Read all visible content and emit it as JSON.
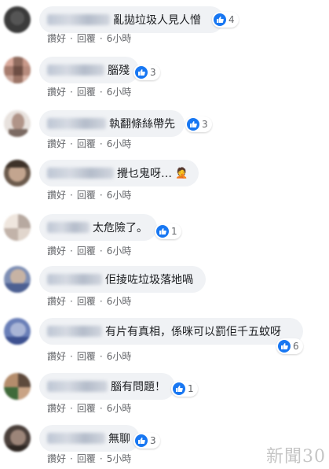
{
  "comments": [
    {
      "name_blur": "",
      "text": "亂拋垃圾人見人憎",
      "emoji": "",
      "likes": "4",
      "actions": {
        "like": "讚好",
        "reply": "回覆",
        "time": "6小時"
      }
    },
    {
      "name_blur": "",
      "text": "腦殘",
      "emoji": "",
      "likes": "3",
      "actions": {
        "like": "讚好",
        "reply": "回覆",
        "time": "6小時"
      }
    },
    {
      "name_blur": "",
      "text": "執翻條絲帶先",
      "emoji": "",
      "likes": "3",
      "actions": {
        "like": "讚好",
        "reply": "回覆",
        "time": "6小時"
      }
    },
    {
      "name_blur": "",
      "text": "攪乜鬼呀…",
      "emoji": "🤦",
      "likes": "",
      "actions": {
        "like": "讚好",
        "reply": "回覆",
        "time": "6小時"
      }
    },
    {
      "name_blur": "",
      "text": "太危險了。",
      "emoji": "",
      "likes": "1",
      "actions": {
        "like": "讚好",
        "reply": "回覆",
        "time": "6小時"
      }
    },
    {
      "name_blur": "",
      "text": "佢掕咗垃圾落地喎",
      "emoji": "",
      "likes": "",
      "actions": {
        "like": "讚好",
        "reply": "回覆",
        "time": "6小時"
      }
    },
    {
      "name_blur": "",
      "text": "有片有真相，係咪可以罰佢千五蚊呀",
      "emoji": "",
      "likes": "6",
      "actions": {
        "like": "讚好",
        "reply": "回覆",
        "time": "6小時"
      }
    },
    {
      "name_blur": "",
      "text": "腦有問題！",
      "emoji": "",
      "likes": "1",
      "actions": {
        "like": "讚好",
        "reply": "回覆",
        "time": "6小時"
      }
    },
    {
      "name_blur": "",
      "text": "無聊",
      "emoji": "",
      "likes": "3",
      "actions": {
        "like": "讚好",
        "reply": "回覆",
        "time": "5小時"
      }
    }
  ],
  "watermark": "新聞30",
  "colors": {
    "like_blue": "#1877f2",
    "bubble_bg": "#f0f2f5",
    "meta_gray": "#65676b"
  }
}
